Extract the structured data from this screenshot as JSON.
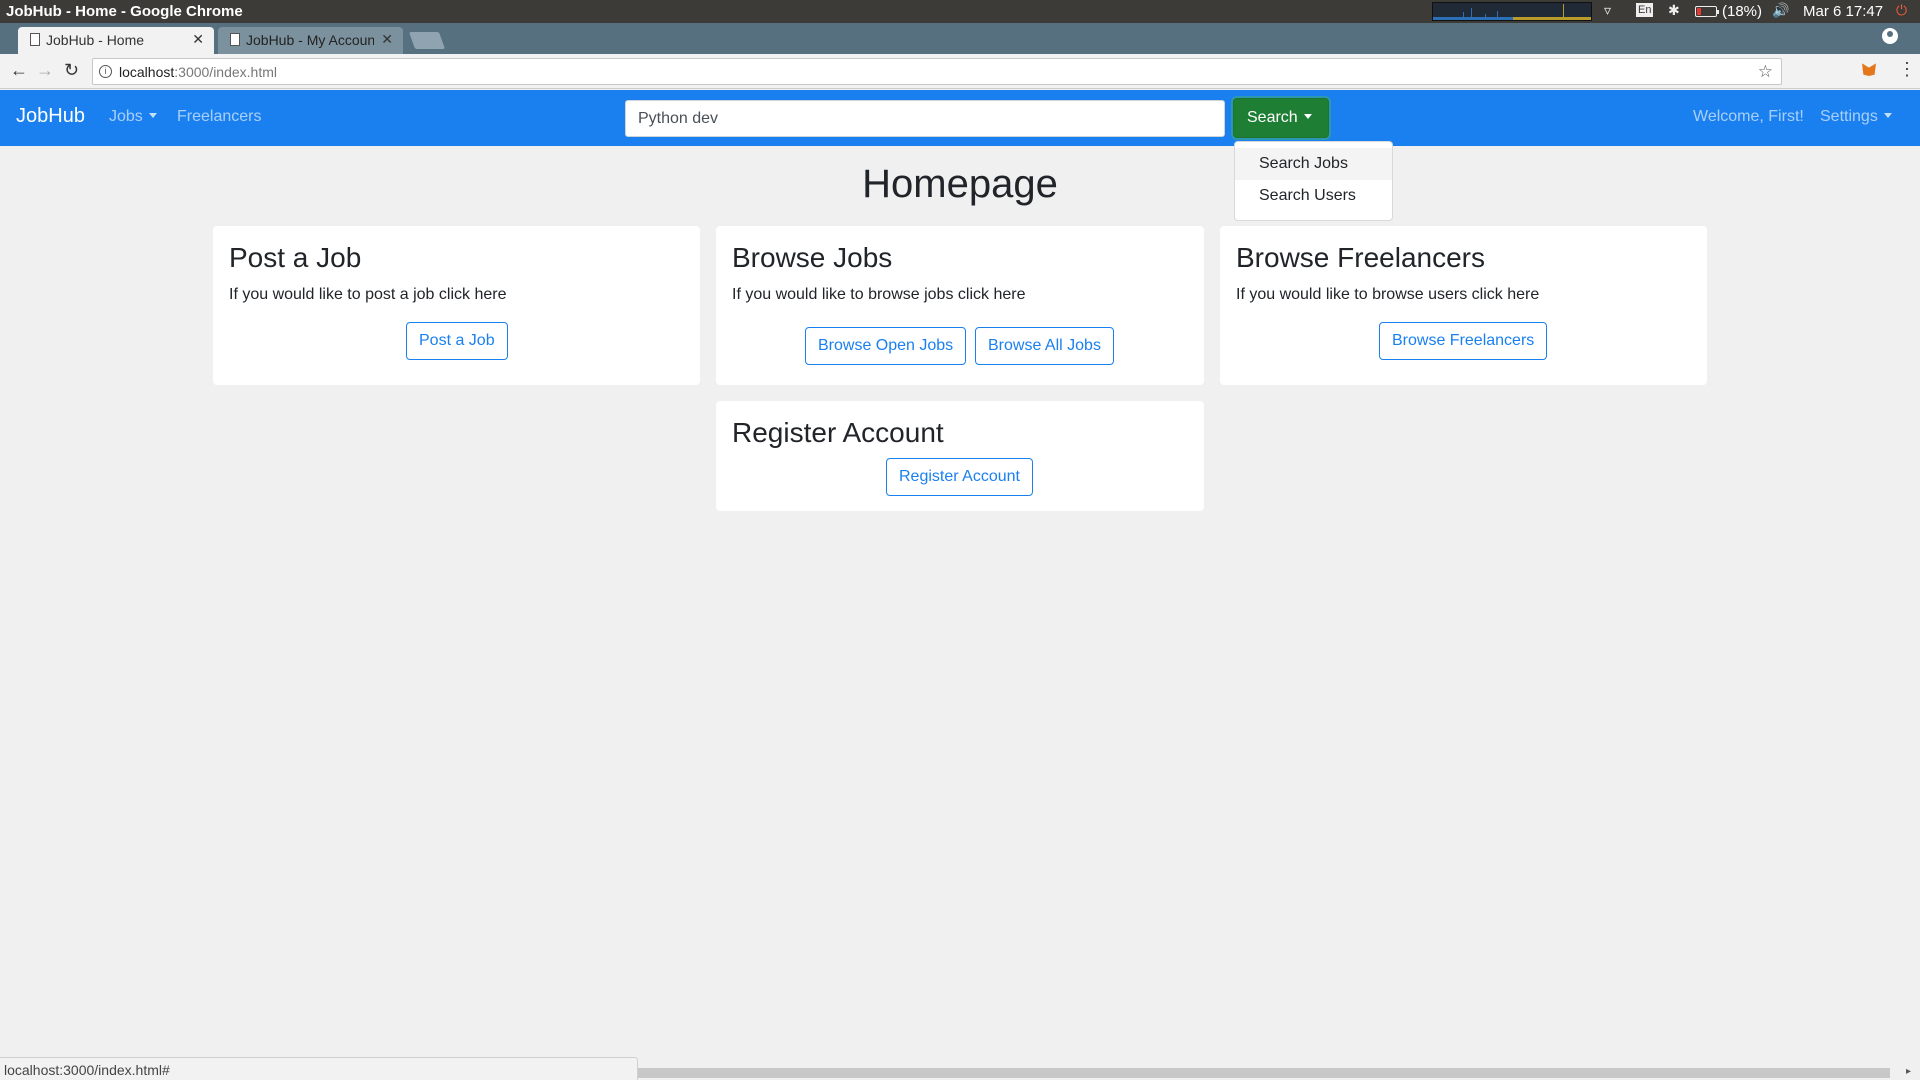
{
  "os": {
    "window_title": "JobHub - Home - Google Chrome",
    "battery": "(18%)",
    "clock": "Mar 6 17:47",
    "keyboard": "En"
  },
  "browser": {
    "tabs": [
      {
        "label": "JobHub - Home",
        "active": true
      },
      {
        "label": "JobHub - My Account",
        "active": false
      }
    ],
    "url_host": "localhost",
    "url_path": ":3000/index.html",
    "status_url": "localhost:3000/index.html#"
  },
  "navbar": {
    "brand": "JobHub",
    "jobs_label": "Jobs",
    "freelancers_label": "Freelancers",
    "search_value": "Python dev",
    "search_button": "Search",
    "welcome": "Welcome, First!",
    "settings_label": "Settings",
    "accent_color": "#1a80f0",
    "search_button_color": "#1e7e34"
  },
  "dropdown": {
    "items": [
      "Search Jobs",
      "Search Users"
    ]
  },
  "page": {
    "title": "Homepage",
    "cards": {
      "post_job": {
        "title": "Post a Job",
        "text": "If you would like to post a job click here",
        "button": "Post a Job"
      },
      "browse_jobs": {
        "title": "Browse Jobs",
        "text": "If you would like to browse jobs click here",
        "button_open": "Browse Open Jobs",
        "button_all": "Browse All Jobs"
      },
      "browse_freelancers": {
        "title": "Browse Freelancers",
        "text": "If you would like to browse users click here",
        "button": "Browse Freelancers"
      },
      "register": {
        "title": "Register Account",
        "button": "Register Account"
      }
    }
  }
}
